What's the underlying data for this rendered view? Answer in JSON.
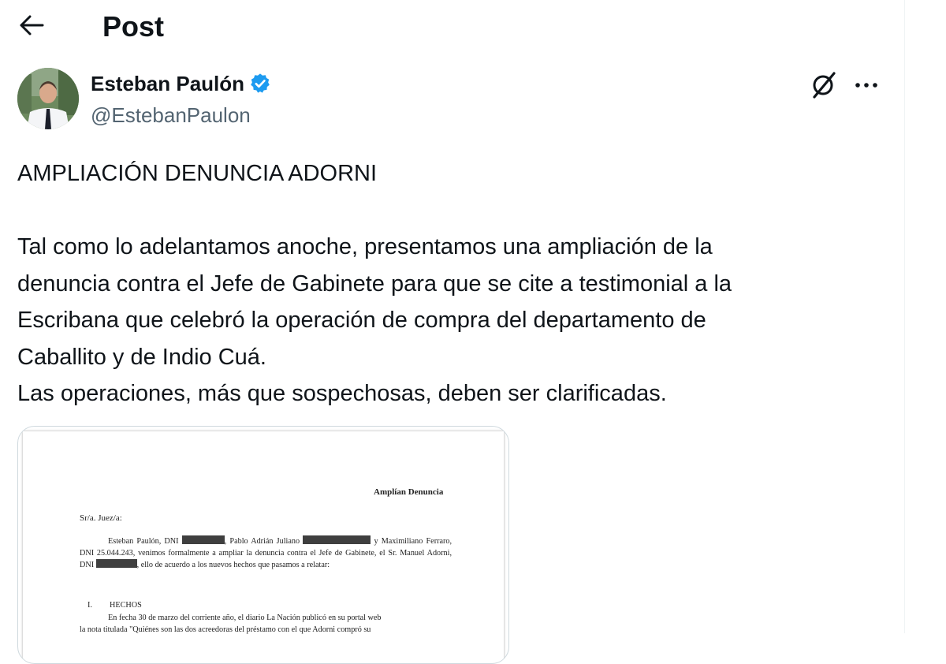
{
  "header": {
    "title": "Post"
  },
  "tweet": {
    "author_name": "Esteban Paulón",
    "handle": "@EstebanPaulon",
    "paragraphs": [
      "AMPLIACIÓN DENUNCIA ADORNI",
      "",
      "Tal como lo adelantamos anoche, presentamos una ampliación de la",
      "denuncia contra el Jefe de Gabinete para que se cite a testimonial a la",
      "Escribana que celebró la operación de compra del departamento de",
      "Caballito y de Indio Cuá.",
      "Las operaciones, más que sospechosas, deben ser clarificadas."
    ]
  },
  "document": {
    "title": "Amplían Denuncia",
    "salutation": "Sr/a. Juez/a:",
    "p1_a": "Esteban Paulón, DNI",
    "p1_b": ", Pablo Adrián Juliano",
    "p1_c": "y Maximiliano Ferraro, DNI 25.044.243, venimos formalmente a ampliar la denuncia contra el Jefe de Gabinete, el Sr. Manuel Adorni, DNI",
    "p1_d": ", ello de acuerdo a los nuevos hechos que pasamos a relatar:",
    "heading_num": "I.",
    "heading": "HECHOS",
    "p2": "En fecha 30 de marzo del corriente año, el diario La Nación publicó en su portal web",
    "p3": "la nota titulada \"Quiénes son las dos acreedoras del préstamo con el que Adorni compró su"
  },
  "colors": {
    "verified": "#1d9bf0",
    "secondary_text": "#536471"
  },
  "icons": {
    "back": "arrow-left-icon",
    "verified": "verified-badge-icon",
    "grok": "grok-icon",
    "more": "more-icon"
  }
}
